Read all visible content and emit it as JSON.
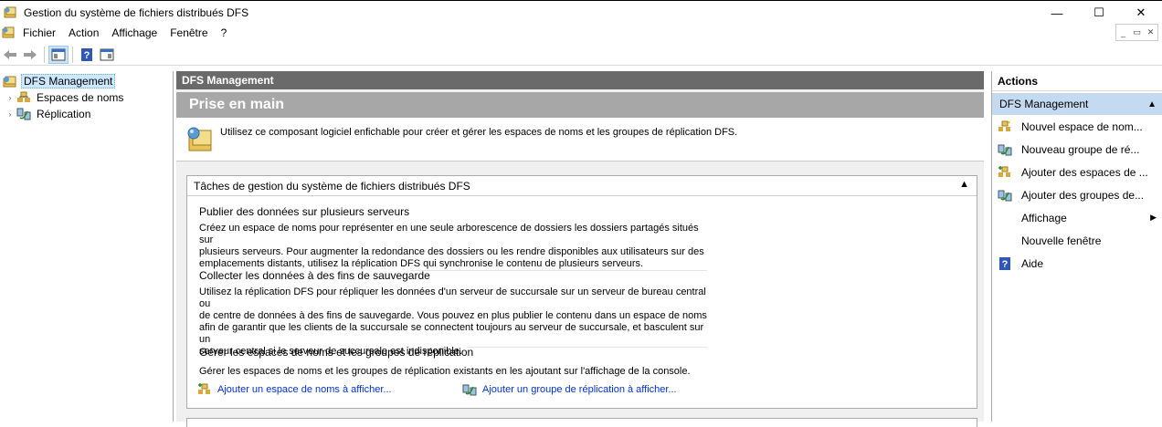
{
  "window": {
    "title": "Gestion du système de fichiers distribués DFS",
    "controls": {
      "minimize": "—",
      "maximize": "☐",
      "close": "✕"
    }
  },
  "menu": [
    "Fichier",
    "Action",
    "Affichage",
    "Fenêtre",
    "?"
  ],
  "mdi_controls": [
    "_",
    "▭",
    "✕"
  ],
  "tree": {
    "root": "DFS Management",
    "children": [
      "Espaces de noms",
      "Réplication"
    ]
  },
  "center": {
    "header": "DFS Management",
    "banner": "Prise en main",
    "intro": "Utilisez ce composant logiciel enfichable pour créer et gérer les espaces de noms et les groupes de réplication DFS.",
    "tasks_title": "Tâches de gestion du système de fichiers distribués DFS",
    "sections": [
      {
        "title": "Publier des données sur plusieurs serveurs",
        "lines": [
          "Créez un espace de noms pour représenter en une seule arborescence de dossiers les dossiers partagés situés sur",
          "plusieurs serveurs. Pour augmenter la redondance des dossiers ou les rendre disponibles aux utilisateurs sur des",
          "emplacements distants, utilisez la réplication DFS qui synchronise le contenu de plusieurs serveurs."
        ]
      },
      {
        "title": "Collecter les données à des fins de sauvegarde",
        "lines": [
          "Utilisez la réplication DFS pour répliquer les données d'un serveur de succursale sur un serveur de bureau central ou",
          "de centre de données à des fins de sauvegarde. Vous pouvez en plus publier le contenu dans un espace de noms",
          "afin de garantir que les clients de la succursale se connectent toujours au serveur de succursale, et basculent sur un",
          "serveur central si le serveur de succursale est indisponible."
        ]
      },
      {
        "title": "Gérer les espaces de noms et les groupes de réplication",
        "lines": [
          "Gérer les espaces de noms et les groupes de réplication existants en les ajoutant sur l'affichage de la console."
        ]
      }
    ],
    "links": [
      "Ajouter un espace de noms à afficher...",
      "Ajouter un groupe de réplication à afficher..."
    ]
  },
  "actions": {
    "title": "Actions",
    "group": "DFS Management",
    "items": [
      "Nouvel espace de nom...",
      "Nouveau groupe de ré...",
      "Ajouter des espaces de ...",
      "Ajouter des groupes de...",
      "Affichage",
      "Nouvelle fenêtre",
      "Aide"
    ]
  }
}
